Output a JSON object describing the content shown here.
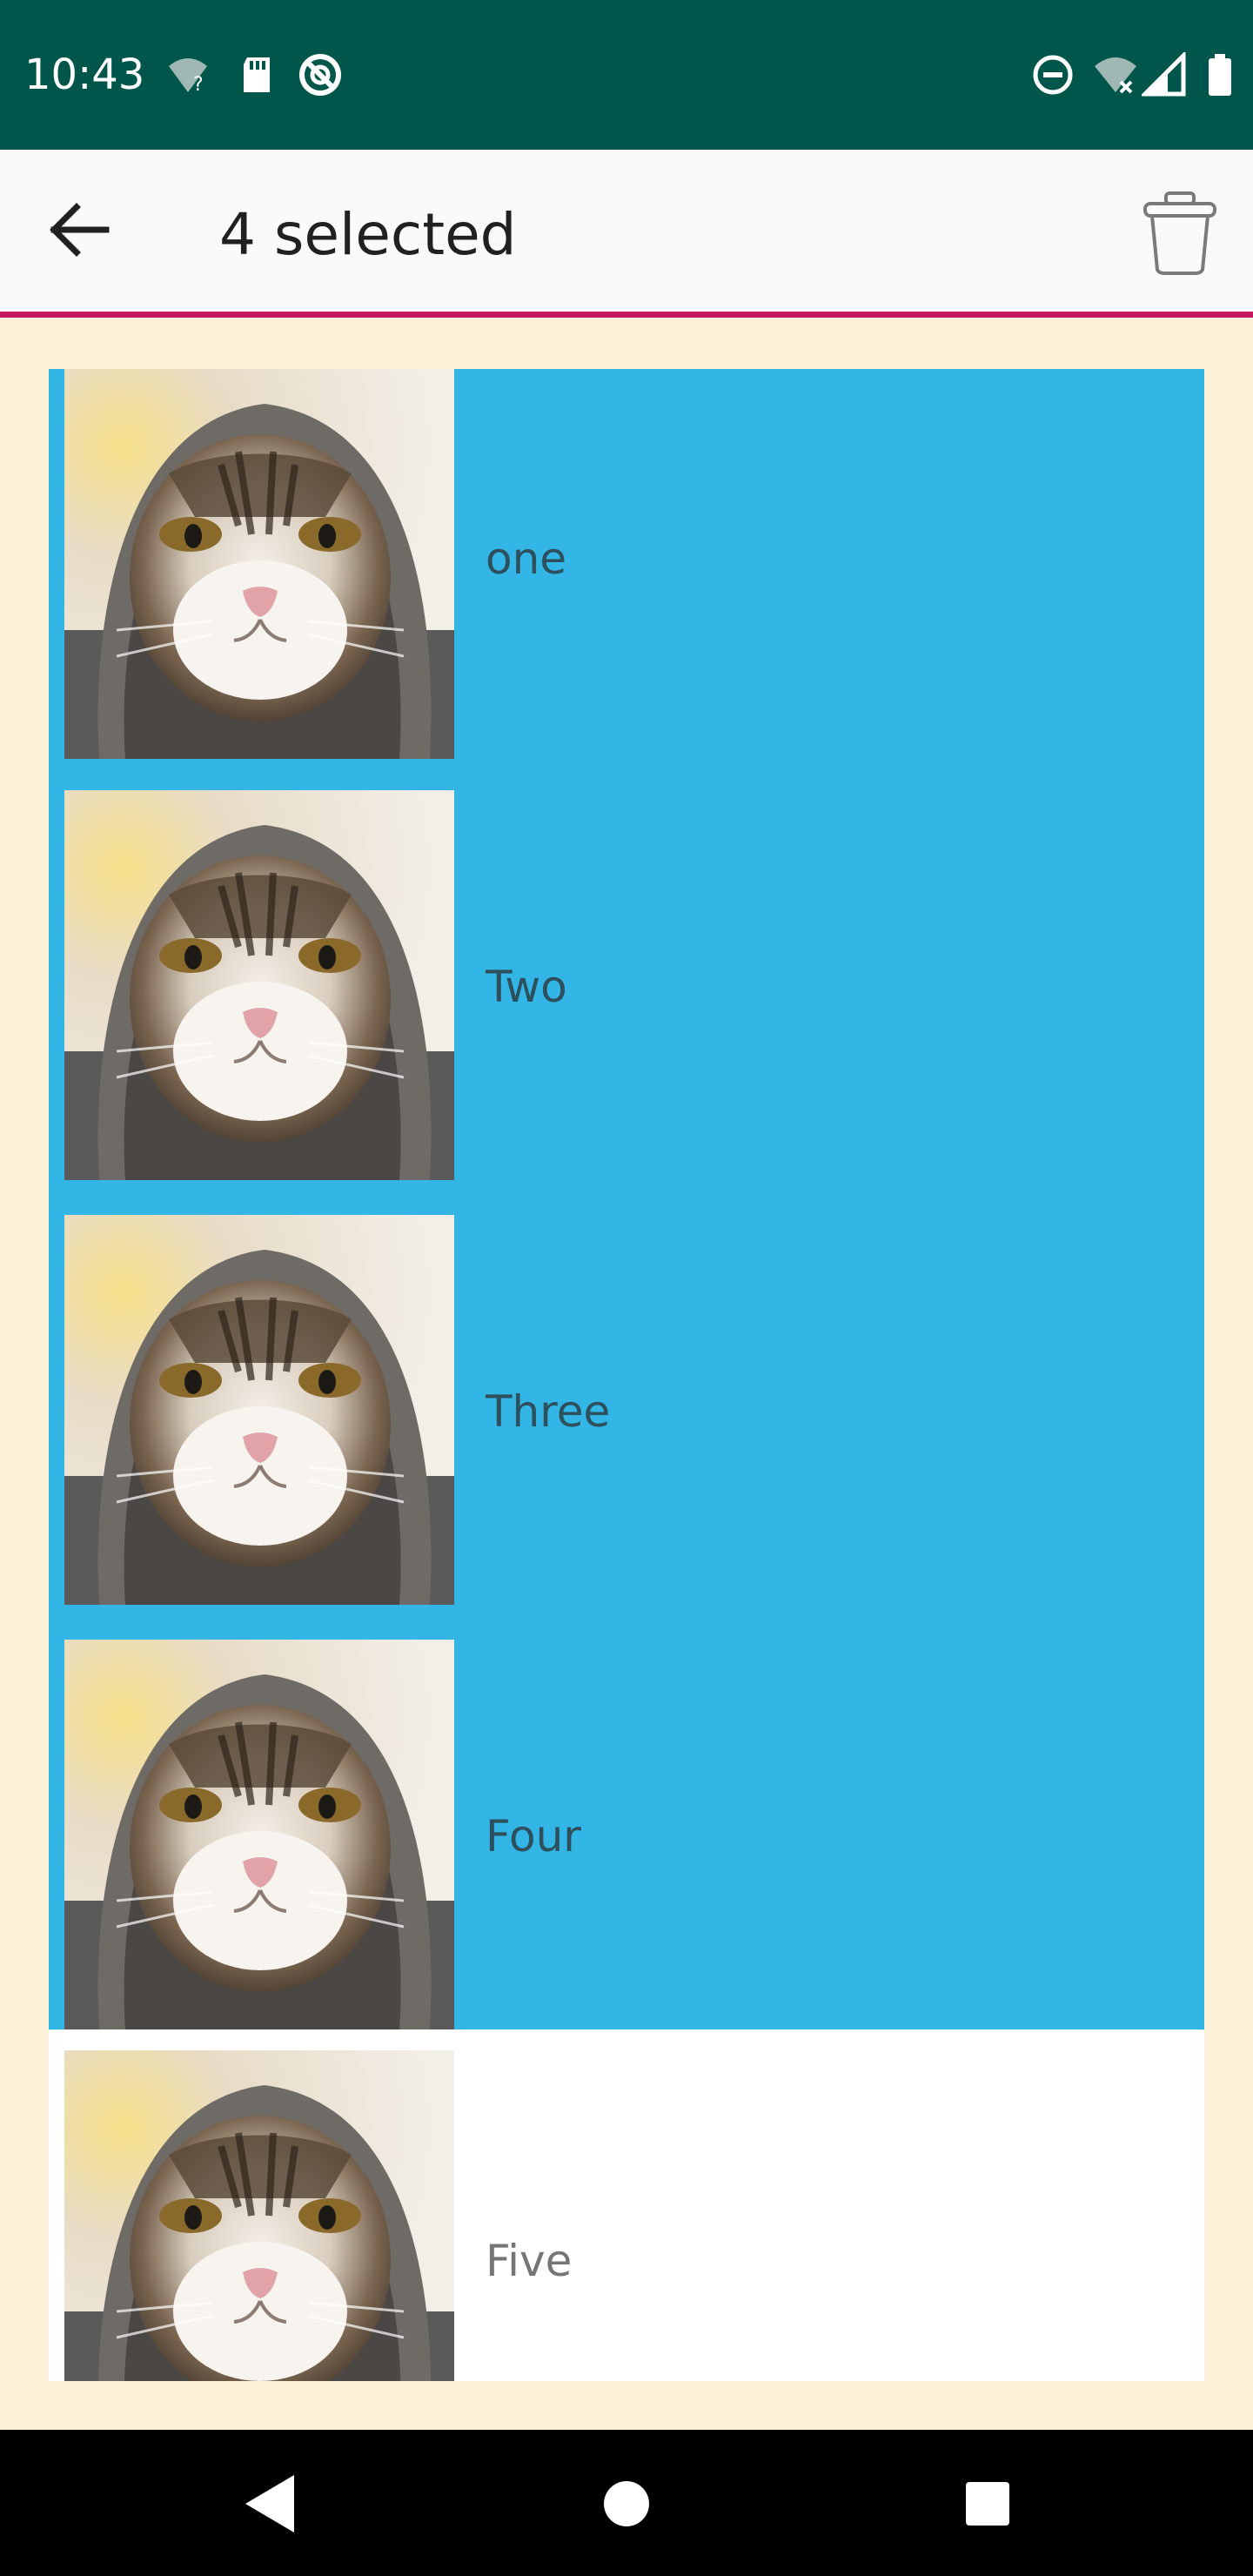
{
  "status_bar": {
    "time": "10:43",
    "left_icons": [
      "wifi-question-icon",
      "sd-card-icon",
      "sync-blocked-icon"
    ],
    "right_icons": [
      "do-not-disturb-icon",
      "wifi-off-icon",
      "signal-icon",
      "battery-icon"
    ]
  },
  "app_bar": {
    "title": "4 selected",
    "back_icon": "arrow-back-icon",
    "action_icon": "trash-can-icon",
    "accent_color": "#C5185F"
  },
  "list": {
    "selected_color": "#33B5E5",
    "items": [
      {
        "label": "one",
        "selected": true,
        "thumbnail": "cat-photo"
      },
      {
        "label": "Two",
        "selected": true,
        "thumbnail": "cat-photo"
      },
      {
        "label": "Three",
        "selected": true,
        "thumbnail": "cat-photo"
      },
      {
        "label": "Four",
        "selected": true,
        "thumbnail": "cat-photo"
      },
      {
        "label": "Five",
        "selected": false,
        "thumbnail": "cat-photo"
      }
    ]
  },
  "nav_bar": {
    "buttons": [
      "back-triangle-icon",
      "home-circle-icon",
      "recents-square-icon"
    ]
  },
  "colors": {
    "status_bar": "#00564A",
    "background": "#FDF0D9"
  }
}
